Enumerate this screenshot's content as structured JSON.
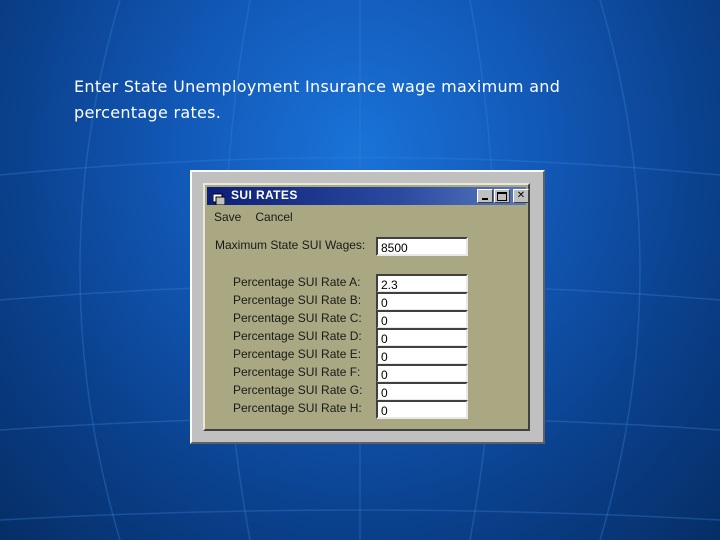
{
  "slide": {
    "caption_line1": "Enter State Unemployment Insurance wage maximum and",
    "caption_line2": "percentage rates."
  },
  "window": {
    "title": "SUI RATES",
    "icon": "app-window-icon",
    "controls": [
      "minimize-icon",
      "maximize-icon",
      "close-icon"
    ]
  },
  "menu": {
    "items": [
      "Save",
      "Cancel"
    ]
  },
  "form": {
    "max_wages": {
      "label": "Maximum State SUI Wages:",
      "value": "8500"
    },
    "rates": [
      {
        "label": "Percentage SUI Rate A:",
        "value": "2.3"
      },
      {
        "label": "Percentage SUI Rate B:",
        "value": "0"
      },
      {
        "label": "Percentage SUI Rate C:",
        "value": "0"
      },
      {
        "label": "Percentage SUI Rate D:",
        "value": "0"
      },
      {
        "label": "Percentage SUI Rate E:",
        "value": "0"
      },
      {
        "label": "Percentage SUI Rate F:",
        "value": "0"
      },
      {
        "label": "Percentage SUI Rate G:",
        "value": "0"
      },
      {
        "label": "Percentage SUI Rate H:",
        "value": "0"
      }
    ]
  },
  "colors": {
    "background": "#1259b8",
    "titlebar": "#0c1e78",
    "window_face": "#a9a883"
  }
}
